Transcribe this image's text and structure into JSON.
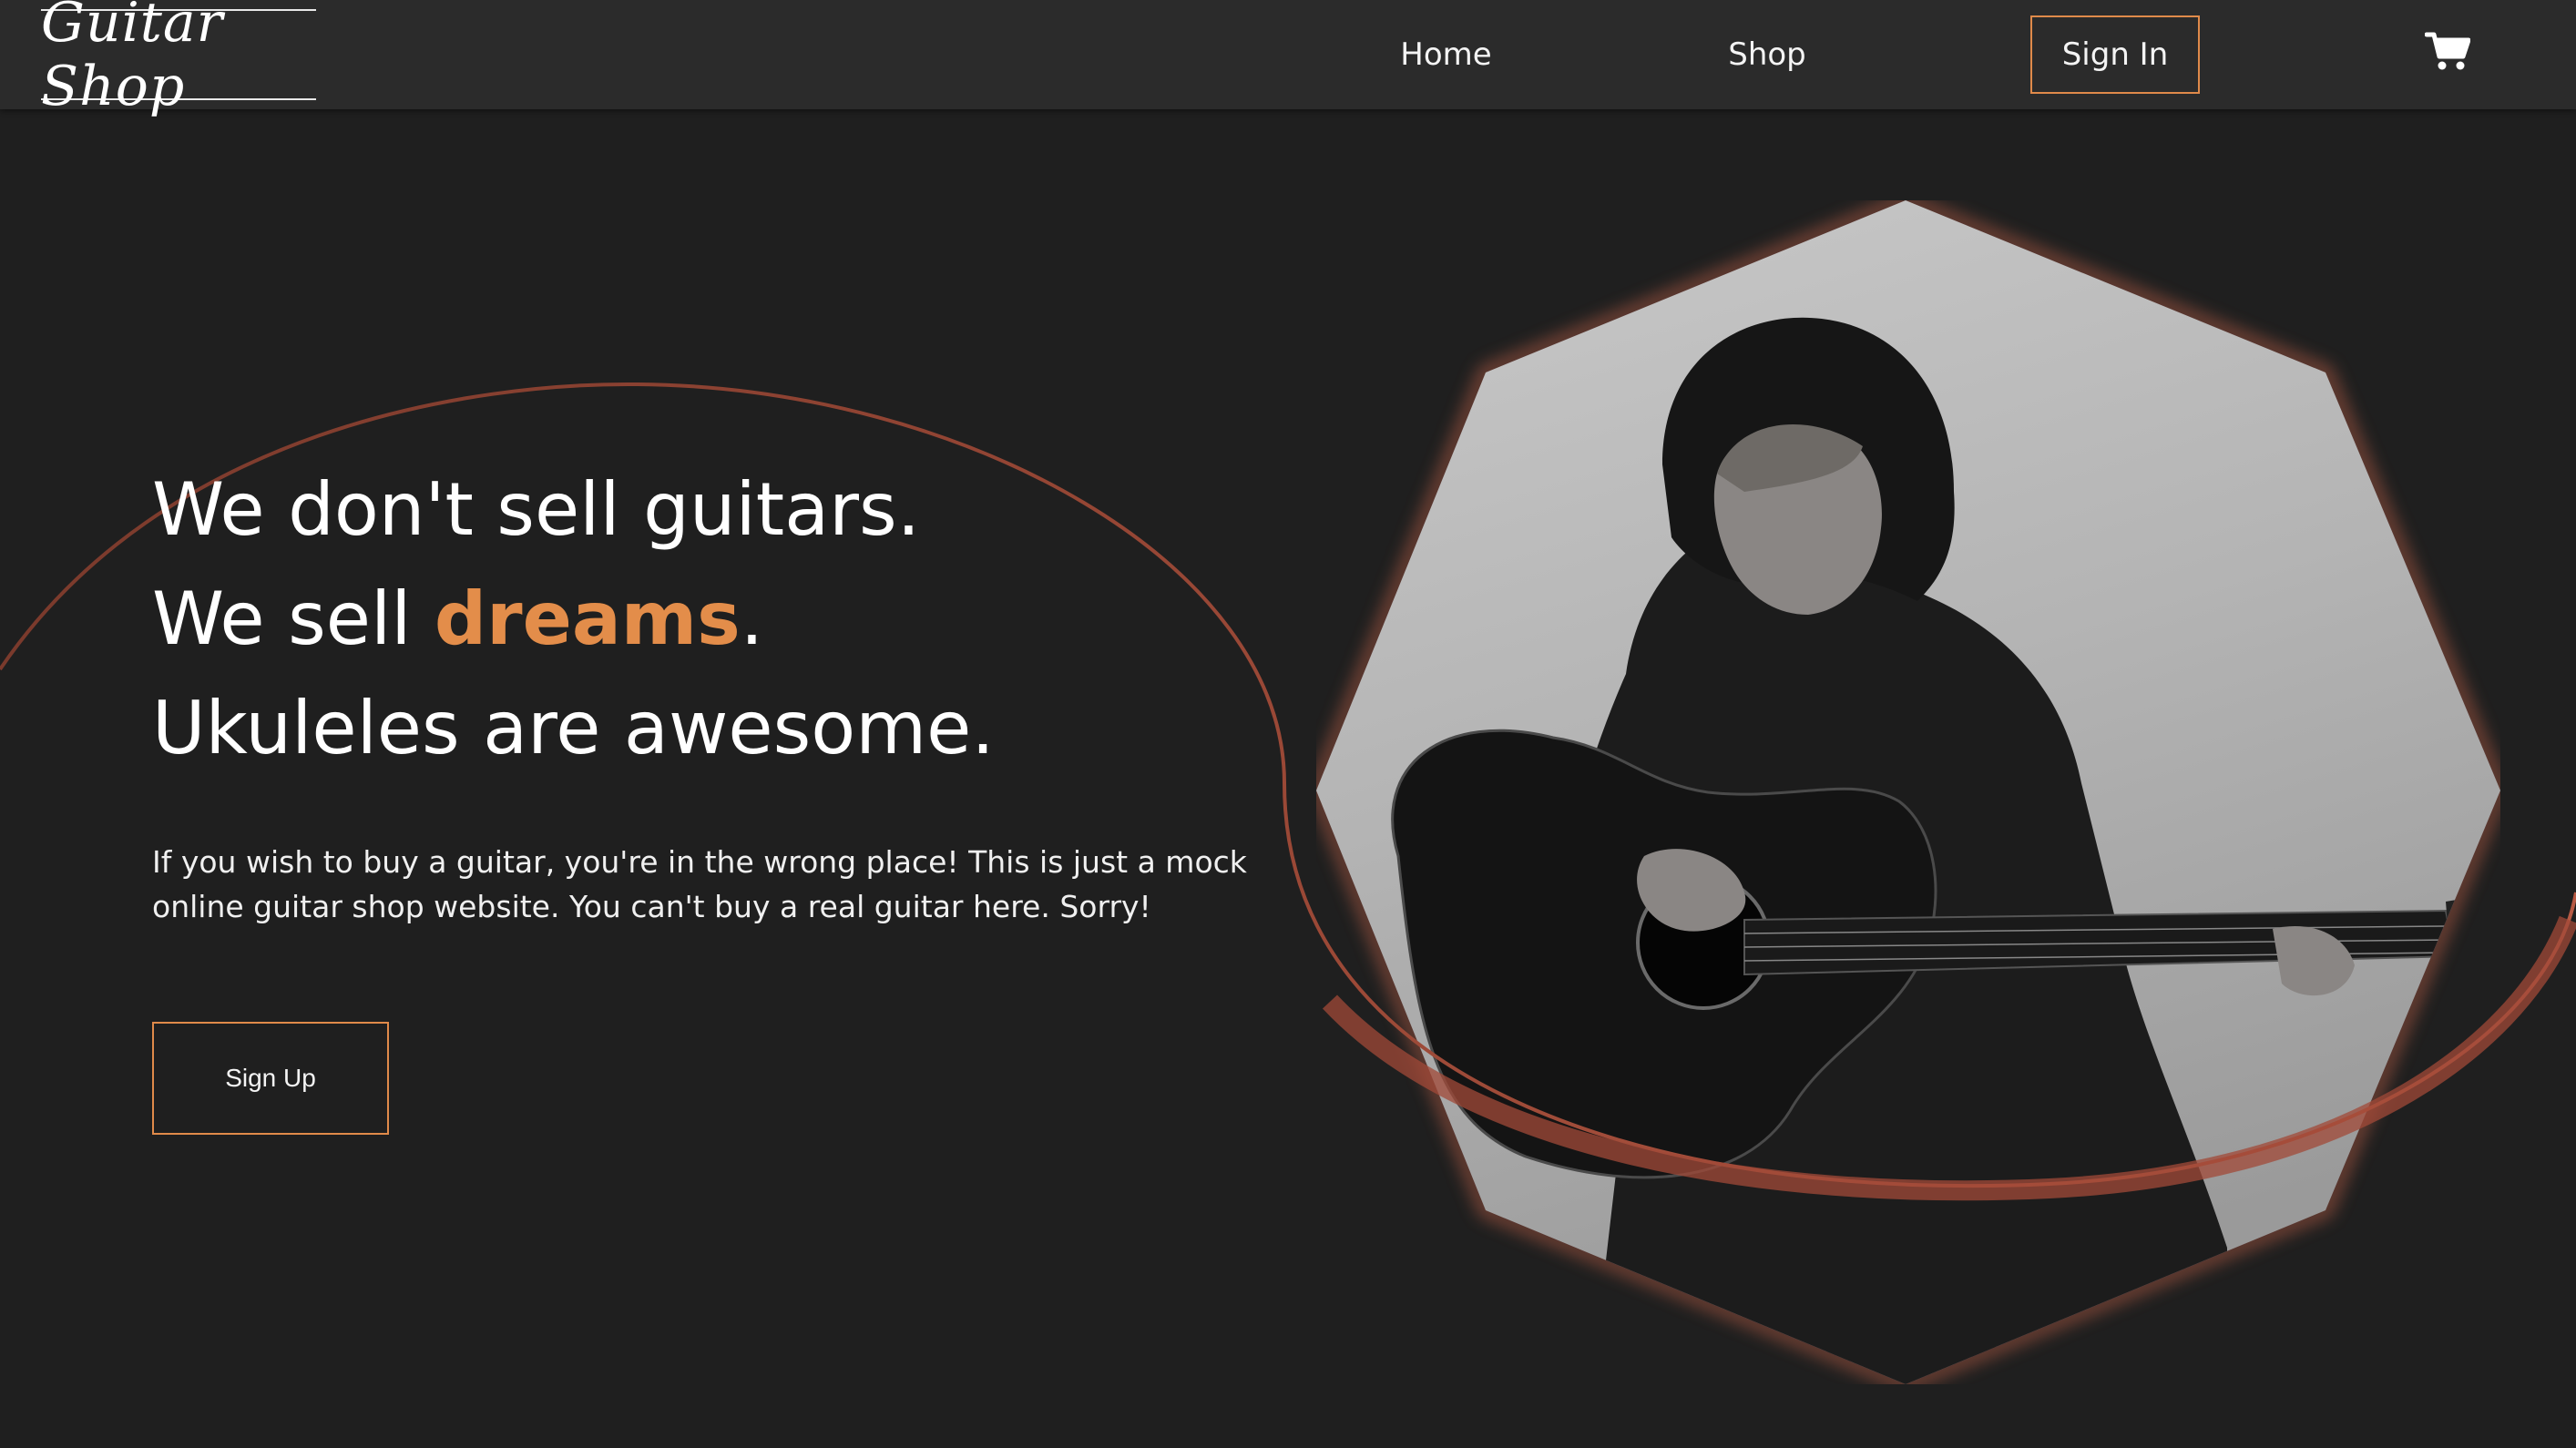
{
  "brand": {
    "logo_text": "Guitar Shop"
  },
  "nav": {
    "home_label": "Home",
    "shop_label": "Shop",
    "signin_label": "Sign In",
    "cart_icon": "shopping-cart-icon"
  },
  "hero": {
    "headline_line1": "We don't sell guitars.",
    "headline_line2_prefix": "We sell ",
    "headline_line2_accent": "dreams",
    "headline_line2_suffix": ".",
    "headline_line3": "Ukuleles are awesome.",
    "description": "If you wish to buy a guitar, you're in the wrong place! This is just a mock online guitar shop website. You can't buy a real guitar here. Sorry!",
    "signup_label": "Sign Up",
    "image_subject": "person in black hoodie playing acoustic guitar"
  },
  "colors": {
    "background": "#1f1f1f",
    "navbar": "#2b2b2b",
    "accent": "#e38d4a",
    "arc": "#a14b38"
  }
}
